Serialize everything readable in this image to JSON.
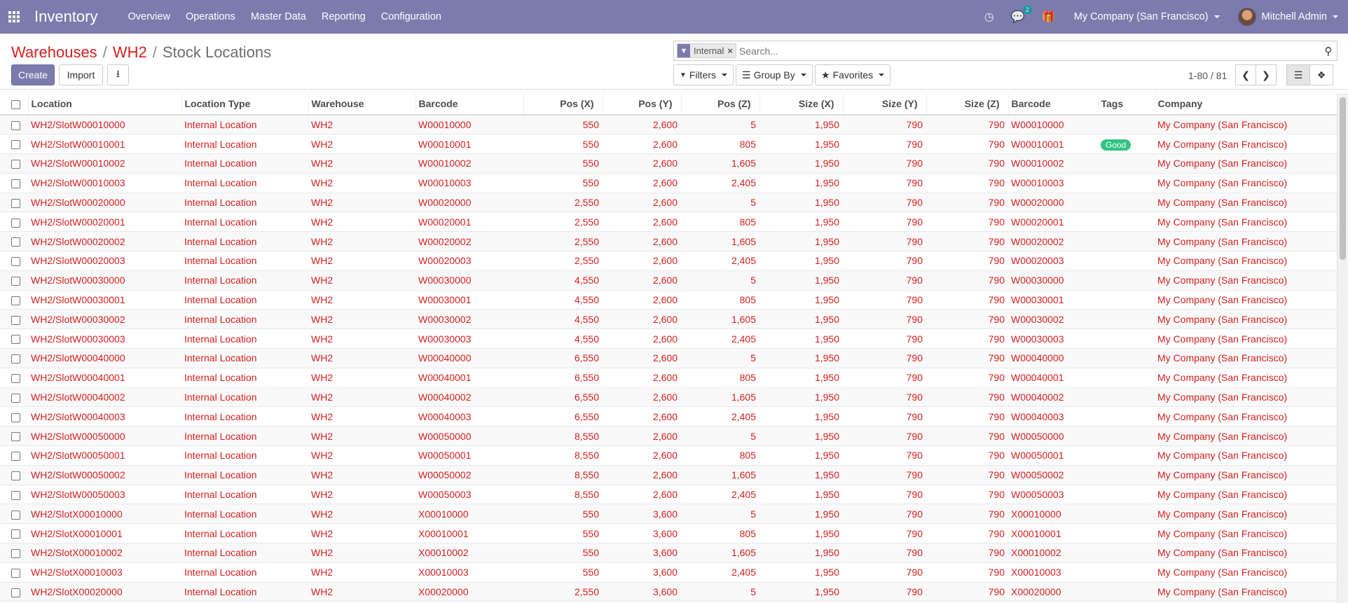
{
  "navbar": {
    "app_title": "Inventory",
    "menu": [
      "Overview",
      "Operations",
      "Master Data",
      "Reporting",
      "Configuration"
    ],
    "chat_count": "2",
    "company": "My Company (San Francisco)",
    "user": "Mitchell Admin"
  },
  "breadcrumb": {
    "items": [
      "Warehouses",
      "WH2"
    ],
    "separator": "/",
    "current": "Stock Locations"
  },
  "buttons": {
    "create": "Create",
    "import": "Import"
  },
  "search": {
    "facet": "Internal",
    "placeholder": "Search..."
  },
  "filters": {
    "filters": "Filters",
    "group_by": "Group By",
    "favorites": "Favorites"
  },
  "pager": {
    "text": "1-80 / 81"
  },
  "table": {
    "columns": [
      "Location",
      "Location Type",
      "Warehouse",
      "Barcode",
      "Pos (X)",
      "Pos (Y)",
      "Pos (Z)",
      "Size (X)",
      "Size (Y)",
      "Size (Z)",
      "Barcode",
      "Tags",
      "Company"
    ],
    "rows": [
      [
        "WH2/SlotW00010000",
        "Internal Location",
        "WH2",
        "W00010000",
        "550",
        "2,600",
        "5",
        "1,950",
        "790",
        "790",
        "W00010000",
        "",
        "My Company (San Francisco)"
      ],
      [
        "WH2/SlotW00010001",
        "Internal Location",
        "WH2",
        "W00010001",
        "550",
        "2,600",
        "805",
        "1,950",
        "790",
        "790",
        "W00010001",
        "Good",
        "My Company (San Francisco)"
      ],
      [
        "WH2/SlotW00010002",
        "Internal Location",
        "WH2",
        "W00010002",
        "550",
        "2,600",
        "1,605",
        "1,950",
        "790",
        "790",
        "W00010002",
        "",
        "My Company (San Francisco)"
      ],
      [
        "WH2/SlotW00010003",
        "Internal Location",
        "WH2",
        "W00010003",
        "550",
        "2,600",
        "2,405",
        "1,950",
        "790",
        "790",
        "W00010003",
        "",
        "My Company (San Francisco)"
      ],
      [
        "WH2/SlotW00020000",
        "Internal Location",
        "WH2",
        "W00020000",
        "2,550",
        "2,600",
        "5",
        "1,950",
        "790",
        "790",
        "W00020000",
        "",
        "My Company (San Francisco)"
      ],
      [
        "WH2/SlotW00020001",
        "Internal Location",
        "WH2",
        "W00020001",
        "2,550",
        "2,600",
        "805",
        "1,950",
        "790",
        "790",
        "W00020001",
        "",
        "My Company (San Francisco)"
      ],
      [
        "WH2/SlotW00020002",
        "Internal Location",
        "WH2",
        "W00020002",
        "2,550",
        "2,600",
        "1,605",
        "1,950",
        "790",
        "790",
        "W00020002",
        "",
        "My Company (San Francisco)"
      ],
      [
        "WH2/SlotW00020003",
        "Internal Location",
        "WH2",
        "W00020003",
        "2,550",
        "2,600",
        "2,405",
        "1,950",
        "790",
        "790",
        "W00020003",
        "",
        "My Company (San Francisco)"
      ],
      [
        "WH2/SlotW00030000",
        "Internal Location",
        "WH2",
        "W00030000",
        "4,550",
        "2,600",
        "5",
        "1,950",
        "790",
        "790",
        "W00030000",
        "",
        "My Company (San Francisco)"
      ],
      [
        "WH2/SlotW00030001",
        "Internal Location",
        "WH2",
        "W00030001",
        "4,550",
        "2,600",
        "805",
        "1,950",
        "790",
        "790",
        "W00030001",
        "",
        "My Company (San Francisco)"
      ],
      [
        "WH2/SlotW00030002",
        "Internal Location",
        "WH2",
        "W00030002",
        "4,550",
        "2,600",
        "1,605",
        "1,950",
        "790",
        "790",
        "W00030002",
        "",
        "My Company (San Francisco)"
      ],
      [
        "WH2/SlotW00030003",
        "Internal Location",
        "WH2",
        "W00030003",
        "4,550",
        "2,600",
        "2,405",
        "1,950",
        "790",
        "790",
        "W00030003",
        "",
        "My Company (San Francisco)"
      ],
      [
        "WH2/SlotW00040000",
        "Internal Location",
        "WH2",
        "W00040000",
        "6,550",
        "2,600",
        "5",
        "1,950",
        "790",
        "790",
        "W00040000",
        "",
        "My Company (San Francisco)"
      ],
      [
        "WH2/SlotW00040001",
        "Internal Location",
        "WH2",
        "W00040001",
        "6,550",
        "2,600",
        "805",
        "1,950",
        "790",
        "790",
        "W00040001",
        "",
        "My Company (San Francisco)"
      ],
      [
        "WH2/SlotW00040002",
        "Internal Location",
        "WH2",
        "W00040002",
        "6,550",
        "2,600",
        "1,605",
        "1,950",
        "790",
        "790",
        "W00040002",
        "",
        "My Company (San Francisco)"
      ],
      [
        "WH2/SlotW00040003",
        "Internal Location",
        "WH2",
        "W00040003",
        "6,550",
        "2,600",
        "2,405",
        "1,950",
        "790",
        "790",
        "W00040003",
        "",
        "My Company (San Francisco)"
      ],
      [
        "WH2/SlotW00050000",
        "Internal Location",
        "WH2",
        "W00050000",
        "8,550",
        "2,600",
        "5",
        "1,950",
        "790",
        "790",
        "W00050000",
        "",
        "My Company (San Francisco)"
      ],
      [
        "WH2/SlotW00050001",
        "Internal Location",
        "WH2",
        "W00050001",
        "8,550",
        "2,600",
        "805",
        "1,950",
        "790",
        "790",
        "W00050001",
        "",
        "My Company (San Francisco)"
      ],
      [
        "WH2/SlotW00050002",
        "Internal Location",
        "WH2",
        "W00050002",
        "8,550",
        "2,600",
        "1,605",
        "1,950",
        "790",
        "790",
        "W00050002",
        "",
        "My Company (San Francisco)"
      ],
      [
        "WH2/SlotW00050003",
        "Internal Location",
        "WH2",
        "W00050003",
        "8,550",
        "2,600",
        "2,405",
        "1,950",
        "790",
        "790",
        "W00050003",
        "",
        "My Company (San Francisco)"
      ],
      [
        "WH2/SlotX00010000",
        "Internal Location",
        "WH2",
        "X00010000",
        "550",
        "3,600",
        "5",
        "1,950",
        "790",
        "790",
        "X00010000",
        "",
        "My Company (San Francisco)"
      ],
      [
        "WH2/SlotX00010001",
        "Internal Location",
        "WH2",
        "X00010001",
        "550",
        "3,600",
        "805",
        "1,950",
        "790",
        "790",
        "X00010001",
        "",
        "My Company (San Francisco)"
      ],
      [
        "WH2/SlotX00010002",
        "Internal Location",
        "WH2",
        "X00010002",
        "550",
        "3,600",
        "1,605",
        "1,950",
        "790",
        "790",
        "X00010002",
        "",
        "My Company (San Francisco)"
      ],
      [
        "WH2/SlotX00010003",
        "Internal Location",
        "WH2",
        "X00010003",
        "550",
        "3,600",
        "2,405",
        "1,950",
        "790",
        "790",
        "X00010003",
        "",
        "My Company (San Francisco)"
      ],
      [
        "WH2/SlotX00020000",
        "Internal Location",
        "WH2",
        "X00020000",
        "2,550",
        "3,600",
        "5",
        "1,950",
        "790",
        "790",
        "X00020000",
        "",
        "My Company (San Francisco)"
      ]
    ]
  }
}
